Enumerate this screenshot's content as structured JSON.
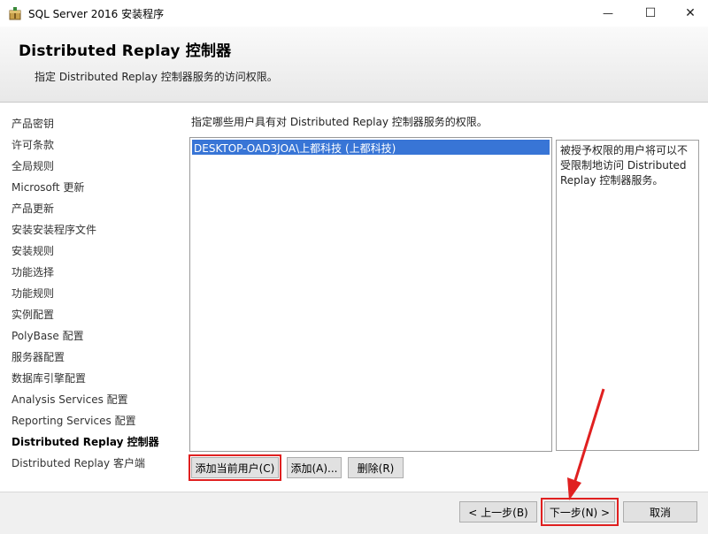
{
  "window": {
    "title": "SQL Server 2016 安装程序",
    "minimize_glyph": "—",
    "maximize_glyph": "☐",
    "close_glyph": "✕"
  },
  "header": {
    "title": "Distributed  Replay 控制器",
    "subtitle": "指定 Distributed Replay 控制器服务的访问权限。"
  },
  "nav": {
    "items": [
      "产品密钥",
      "许可条款",
      "全局规则",
      "Microsoft 更新",
      "产品更新",
      "安装安装程序文件",
      "安装规则",
      "功能选择",
      "功能规则",
      "实例配置",
      "PolyBase 配置",
      "服务器配置",
      "数据库引擎配置",
      "Analysis Services 配置",
      "Reporting Services 配置",
      "Distributed Replay 控制器",
      "Distributed Replay 客户端"
    ],
    "active_index": 15
  },
  "main": {
    "instruction": "指定哪些用户具有对 Distributed Replay 控制器服务的权限。",
    "users": [
      "DESKTOP-OAD3JOA\\上都科技 (上都科技)"
    ],
    "info": "被授予权限的用户将可以不受限制地访问 Distributed Replay 控制器服务。",
    "buttons": {
      "add_current": "添加当前用户(C)",
      "add": "添加(A)...",
      "delete": "删除(R)"
    }
  },
  "footer": {
    "back": "< 上一步(B)",
    "next": "下一步(N) >",
    "cancel": "取消"
  },
  "colors": {
    "selection": "#3875d6",
    "highlight": "#e02020"
  }
}
